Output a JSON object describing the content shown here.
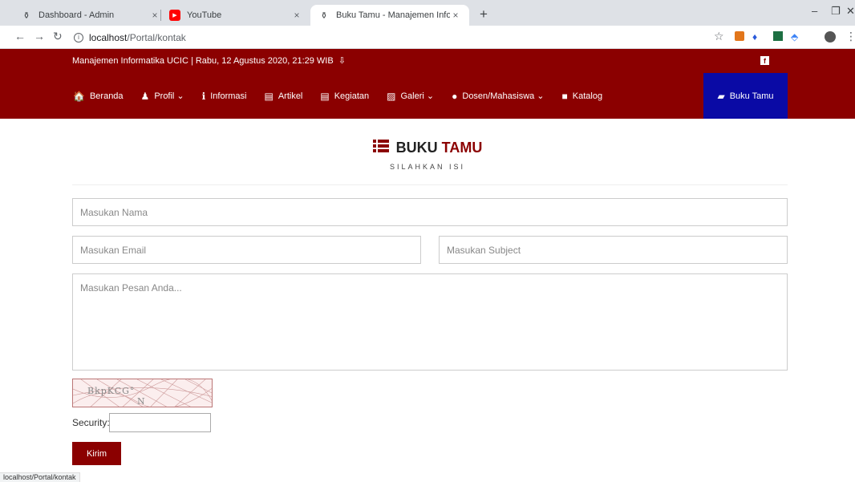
{
  "browser": {
    "tabs": [
      {
        "title": "Dashboard - Admin",
        "close": "×"
      },
      {
        "title": "YouTube",
        "close": "×"
      },
      {
        "title": "Buku Tamu - Manajemen Informa",
        "close": "×"
      }
    ],
    "new_tab": "+",
    "window_controls": [
      "–",
      "❐",
      "✕"
    ],
    "url_host": "localhost",
    "url_path": "/Portal/kontak"
  },
  "site": {
    "top_info": "Manajemen Informatika UCIC | Rabu, 12 Agustus 2020, 21:29 WIB",
    "menu": [
      {
        "label": "Beranda",
        "icon": "home-icon",
        "glyph": "🏠"
      },
      {
        "label": "Profil ⌄",
        "icon": "profile-icon",
        "glyph": "♟"
      },
      {
        "label": "Informasi",
        "icon": "info-icon",
        "glyph": "ℹ"
      },
      {
        "label": "Artikel",
        "icon": "newspaper-icon",
        "glyph": "▤"
      },
      {
        "label": "Kegiatan",
        "icon": "newspaper-icon",
        "glyph": "▤"
      },
      {
        "label": "Galeri ⌄",
        "icon": "image-icon",
        "glyph": "▨"
      },
      {
        "label": "Dosen/Mahasiswa ⌄",
        "icon": "user-icon",
        "glyph": "●"
      },
      {
        "label": "Katalog",
        "icon": "folder-icon",
        "glyph": "■"
      }
    ],
    "active_menu": {
      "label": "Buku Tamu",
      "icon": "book-icon",
      "glyph": "▰"
    },
    "colors": {
      "brand": "#8b0000",
      "active": "#0a0aa5"
    }
  },
  "page": {
    "title_part1": "BUKU",
    "title_part2": "TAMU",
    "subtitle": "SILAHKAN ISI",
    "form": {
      "name_placeholder": "Masukan Nama",
      "email_placeholder": "Masukan Email",
      "subject_placeholder": "Masukan Subject",
      "message_placeholder": "Masukan Pesan Anda...",
      "captcha_text": "BkpKCG°",
      "captcha_text2": "N",
      "security_label": "Security:",
      "submit_label": "Kirim"
    }
  },
  "status_url": "localhost/Portal/kontak"
}
